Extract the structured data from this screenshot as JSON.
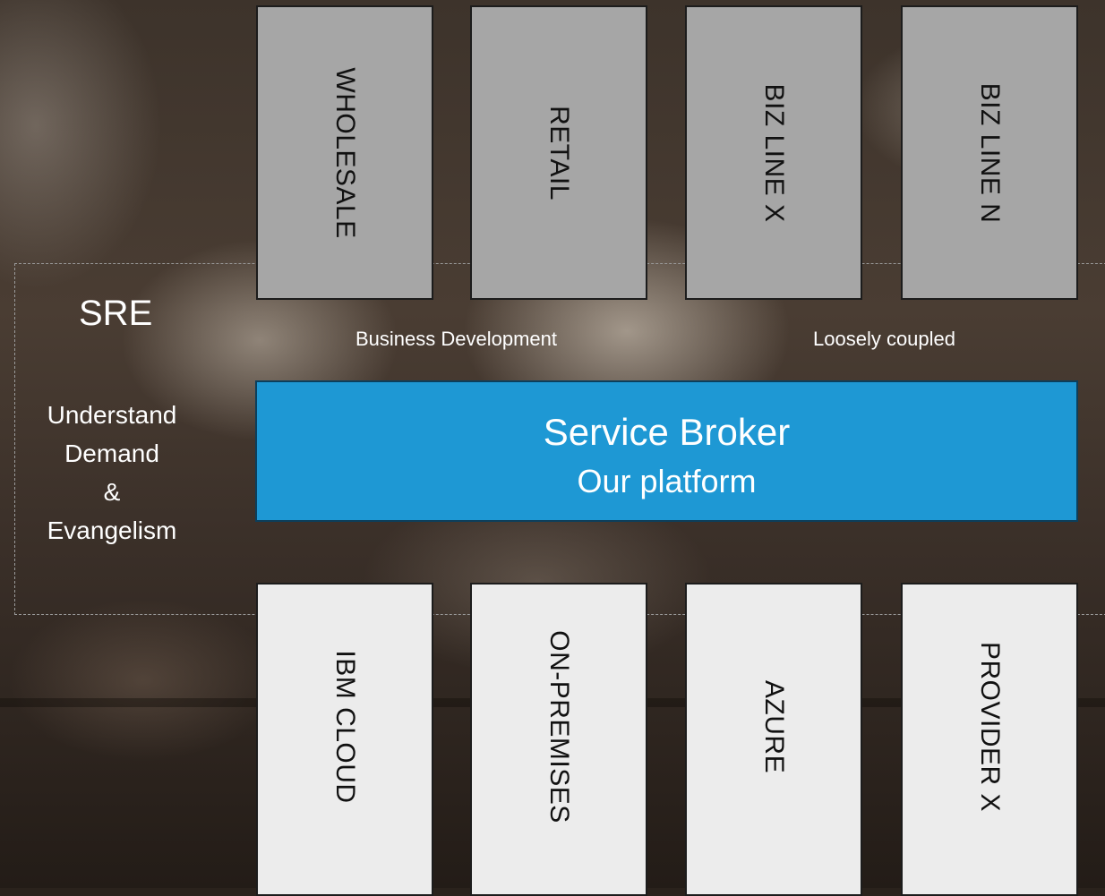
{
  "colors": {
    "broker_fill": "#1e98d4",
    "consumer_box": "#a6a6a6",
    "provider_box": "#ececec",
    "text_light": "#ffffff"
  },
  "sre": {
    "title": "SRE",
    "lines": [
      "Understand",
      "Demand",
      "&",
      "Evangelism"
    ]
  },
  "consumers": [
    "WHOLESALE",
    "RETAIL",
    "BIZ LINE X",
    "BIZ LINE N"
  ],
  "providers": [
    "IBM CLOUD",
    "ON-PREMISES",
    "AZURE",
    "PROVIDER X"
  ],
  "captions": {
    "left": "Business Development",
    "right": "Loosely coupled"
  },
  "broker": {
    "title": "Service Broker",
    "subtitle": "Our platform"
  }
}
